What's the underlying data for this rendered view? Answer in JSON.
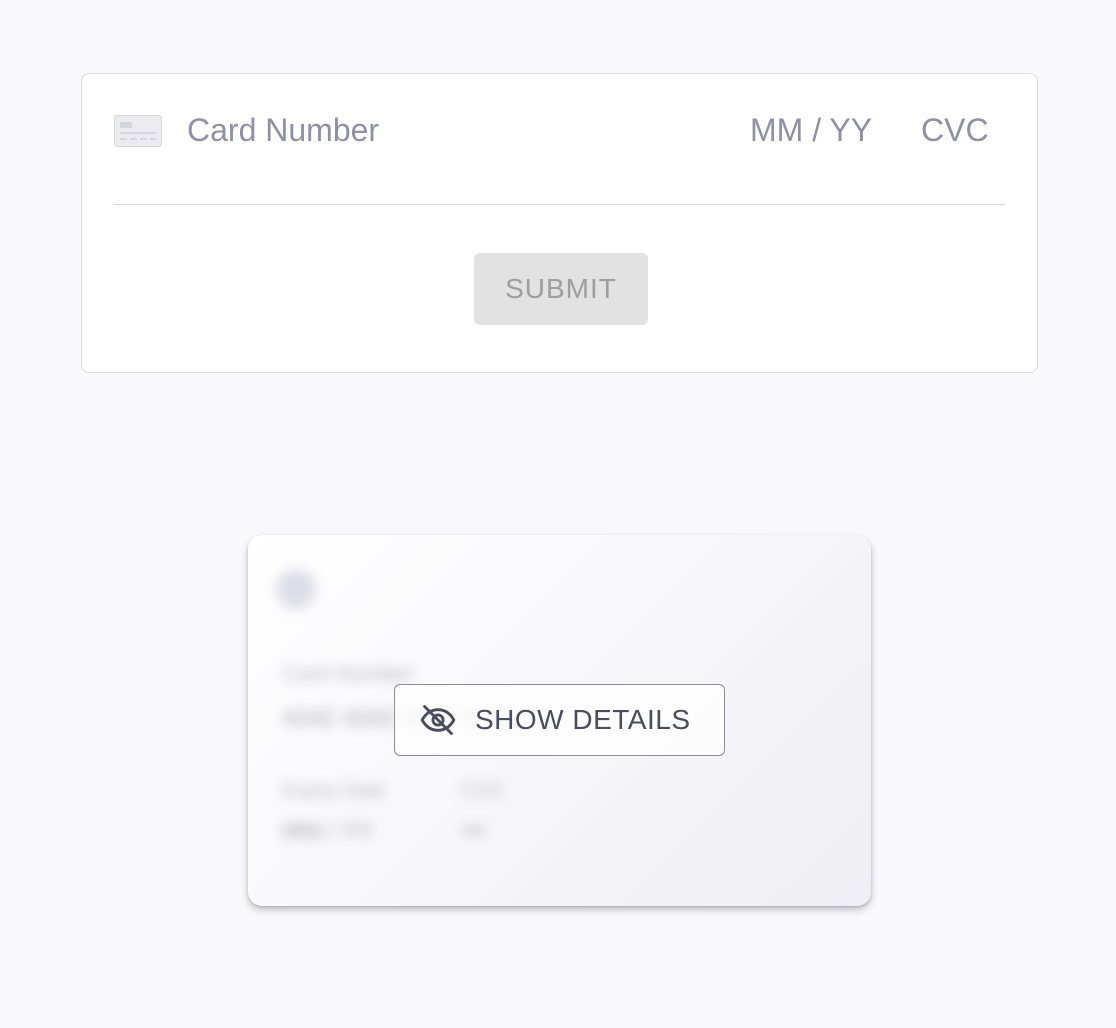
{
  "payment_form": {
    "card_number_placeholder": "Card Number",
    "expiry_placeholder": "MM / YY",
    "cvc_placeholder": "CVC",
    "submit_label": "SUBMIT",
    "card_icon": "credit-card-icon"
  },
  "virtual_card": {
    "show_details_label": "SHOW DETAILS",
    "show_icon": "eye-slash-icon",
    "blurred_texts": {
      "card_number_label": "Card Number",
      "card_number_value": "4242 4242 4242 4242",
      "expiry_label": "Expiry Date",
      "cvc_label": "CVC",
      "expiry_value": "MM / YY",
      "cvc_value": "•••"
    }
  },
  "colors": {
    "background": "#f8f8fd",
    "placeholder_text": "#8f90a3",
    "submit_disabled": "#e2e2e2",
    "button_text": "#4c4c5c"
  }
}
